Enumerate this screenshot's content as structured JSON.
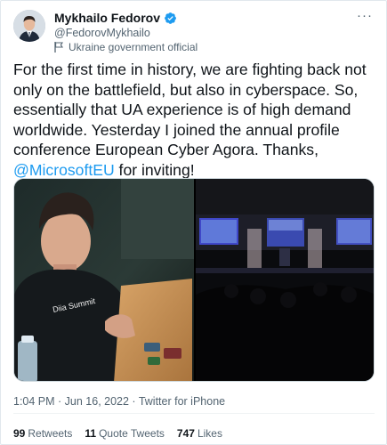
{
  "author": {
    "name": "Mykhailo Fedorov",
    "handle": "@FedorovMykhailo",
    "label": "Ukraine government official",
    "verified_color": "#1d9bf0"
  },
  "menu": {
    "more_icon": "more-horizontal-icon"
  },
  "tweet": {
    "text_before_mention": "For the first time in history, we are fighting back not only on the battlefield, but also in cyberspace. So, essentially that UA experience is of high demand worldwide. Yesterday I joined the annual profile conference European Cyber Agora. Thanks, ",
    "mention": "@MicrosoftEU",
    "text_after_mention": " for inviting!"
  },
  "media": {
    "photo_1_laptop_text": "Diia Summit"
  },
  "meta": {
    "timestamp": "1:04 PM · Jun 16, 2022 · Twitter for iPhone"
  },
  "stats": {
    "retweets_count": "99",
    "retweets_label": "Retweets",
    "quotes_count": "11",
    "quotes_label": "Quote Tweets",
    "likes_count": "747",
    "likes_label": "Likes"
  },
  "colors": {
    "accent": "#1d9bf0",
    "text_primary": "#0f1419",
    "text_secondary": "#536471"
  }
}
